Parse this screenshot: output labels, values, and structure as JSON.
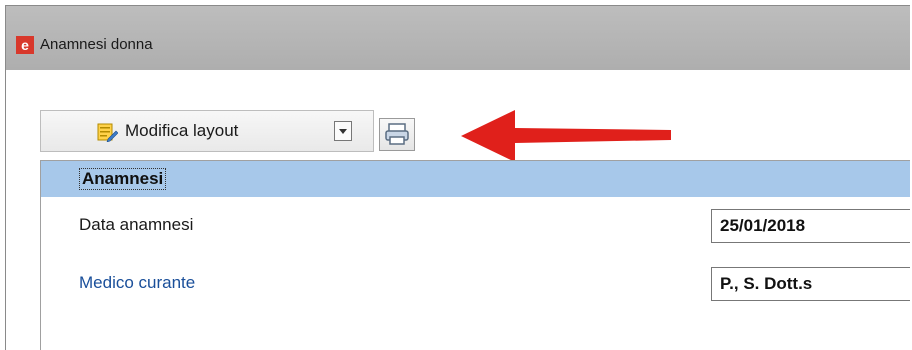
{
  "window": {
    "title": "Anamnesi donna",
    "icon": "app-e-icon"
  },
  "toolbar": {
    "modify_label": "Modifica layout",
    "modify_icon": "edit-layout-icon",
    "dropdown_icon": "chevron-down-icon",
    "print_icon": "printer-icon"
  },
  "annotation": {
    "arrow_color": "#e0201b"
  },
  "section": {
    "title": "Anamnesi"
  },
  "fields": [
    {
      "label": "Data anamnesi",
      "value": "25/01/2018"
    },
    {
      "label": "Medico curante",
      "value": "P., S. Dott.s"
    }
  ],
  "colors": {
    "section_bg": "#a7c8ea",
    "titlebar_bg": "#b5b5b5",
    "link_blue": "#1a4f9a"
  }
}
